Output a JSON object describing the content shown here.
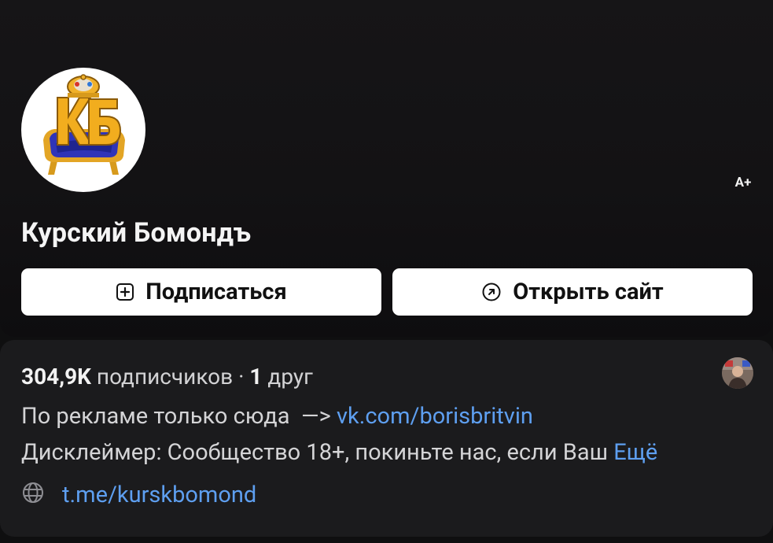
{
  "header": {
    "title": "Курский Бомондъ",
    "age_badge": "A+",
    "subscribe_label": "Подписаться",
    "open_site_label": "Открыть сайт",
    "avatar_icon": "kb-crown-throne-logo"
  },
  "info": {
    "subscribers_count": "304,9K",
    "subscribers_word": "подписчиков",
    "separator": "·",
    "friends_count": "1",
    "friends_word": "друг",
    "description_line1_text": "По рекламе только сюда  —> ",
    "description_line1_link": "vk.com/borisbritvin",
    "description_line2_text": "Дисклеймер: Сообщество 18+, покиньте нас, если Ваш ",
    "more_label": "Ещё",
    "website": "t.me/kurskbomond"
  },
  "colors": {
    "link": "#5e9ff0",
    "background": "#0f0f10",
    "card": "#1b1b1d",
    "button": "#ffffff"
  }
}
